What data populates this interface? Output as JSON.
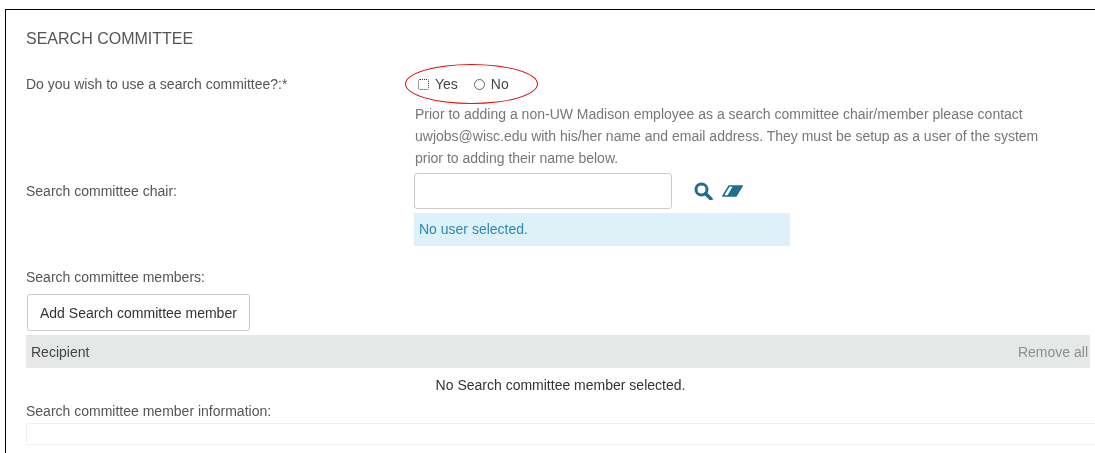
{
  "section_title": "SEARCH COMMITTEE",
  "question": {
    "label": "Do you wish to use a search committee?:*",
    "options": [
      {
        "label": "Yes",
        "selected": false,
        "focused": true
      },
      {
        "label": "No",
        "selected": false,
        "focused": false
      }
    ],
    "highlighted": true
  },
  "help_text": "Prior to adding a non-UW Madison employee as a search committee chair/member please contact uwjobs@wisc.edu with his/her name and email address. They must be setup as a user of the system prior to adding their name below.",
  "chair": {
    "label": "Search committee chair:",
    "status": "No user selected."
  },
  "members": {
    "label": "Search committee members:",
    "add_button": "Add Search committee member",
    "columns": [
      "Recipient"
    ],
    "remove_all": "Remove all",
    "empty_message": "No Search committee member selected."
  },
  "member_info_label": "Search committee member information:"
}
